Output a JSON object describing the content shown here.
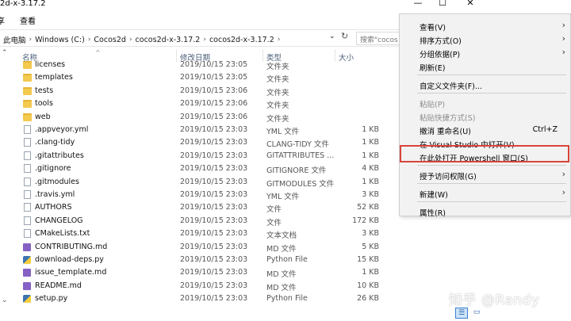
{
  "window": {
    "title": "2d-x-3.17.2",
    "controls": {
      "minimize": "—",
      "maximize": "☐",
      "close": "✕"
    }
  },
  "ribbon": {
    "left_fragment": "享",
    "view_tab": "查看"
  },
  "address": {
    "crumbs": [
      "此电脑",
      "Windows (C:)",
      "Cocos2d",
      "cocos2d-x-3.17.2",
      "cocos2d-x-3.17.2"
    ],
    "separator": "›",
    "search_placeholder": "搜索\"cocos"
  },
  "columns": {
    "name": "名称",
    "date": "修改日期",
    "type": "类型",
    "size": "大小"
  },
  "files": [
    {
      "name": "licenses",
      "date": "2019/10/15 23:05",
      "type": "文件夹",
      "size": "",
      "icon": "folder"
    },
    {
      "name": "templates",
      "date": "2019/10/15 23:05",
      "type": "文件夹",
      "size": "",
      "icon": "folder"
    },
    {
      "name": "tests",
      "date": "2019/10/15 23:06",
      "type": "文件夹",
      "size": "",
      "icon": "folder"
    },
    {
      "name": "tools",
      "date": "2019/10/15 23:06",
      "type": "文件夹",
      "size": "",
      "icon": "folder"
    },
    {
      "name": "web",
      "date": "2019/10/15 23:06",
      "type": "文件夹",
      "size": "",
      "icon": "folder"
    },
    {
      "name": ".appveyor.yml",
      "date": "2019/10/15 23:03",
      "type": "YML 文件",
      "size": "1 KB",
      "icon": "file"
    },
    {
      "name": ".clang-tidy",
      "date": "2019/10/15 23:03",
      "type": "CLANG-TIDY 文件",
      "size": "1 KB",
      "icon": "file"
    },
    {
      "name": ".gitattributes",
      "date": "2019/10/15 23:03",
      "type": "GITATTRIBUTES ...",
      "size": "1 KB",
      "icon": "file"
    },
    {
      "name": ".gitignore",
      "date": "2019/10/15 23:03",
      "type": "GITIGNORE 文件",
      "size": "4 KB",
      "icon": "file"
    },
    {
      "name": ".gitmodules",
      "date": "2019/10/15 23:03",
      "type": "GITMODULES 文件",
      "size": "1 KB",
      "icon": "file"
    },
    {
      "name": ".travis.yml",
      "date": "2019/10/15 23:03",
      "type": "YML 文件",
      "size": "3 KB",
      "icon": "file"
    },
    {
      "name": "AUTHORS",
      "date": "2019/10/15 23:03",
      "type": "文件",
      "size": "52 KB",
      "icon": "file"
    },
    {
      "name": "CHANGELOG",
      "date": "2019/10/15 23:03",
      "type": "文件",
      "size": "172 KB",
      "icon": "file"
    },
    {
      "name": "CMakeLists.txt",
      "date": "2019/10/15 23:03",
      "type": "文本文档",
      "size": "3 KB",
      "icon": "file"
    },
    {
      "name": "CONTRIBUTING.md",
      "date": "2019/10/15 23:03",
      "type": "MD 文件",
      "size": "5 KB",
      "icon": "vs"
    },
    {
      "name": "download-deps.py",
      "date": "2019/10/15 23:03",
      "type": "Python File",
      "size": "15 KB",
      "icon": "py"
    },
    {
      "name": "issue_template.md",
      "date": "2019/10/15 23:03",
      "type": "MD 文件",
      "size": "1 KB",
      "icon": "vs"
    },
    {
      "name": "README.md",
      "date": "2019/10/15 23:03",
      "type": "MD 文件",
      "size": "10 KB",
      "icon": "vs"
    },
    {
      "name": "setup.py",
      "date": "2019/10/15 23:03",
      "type": "Python File",
      "size": "26 KB",
      "icon": "py"
    }
  ],
  "context_menu": {
    "items": [
      {
        "label": "查看(V)",
        "arrow": "›",
        "shortcut": "",
        "disabled": false
      },
      {
        "label": "排序方式(O)",
        "arrow": "›",
        "shortcut": "",
        "disabled": false
      },
      {
        "label": "分组依据(P)",
        "arrow": "›",
        "shortcut": "",
        "disabled": false
      },
      {
        "label": "刷新(E)",
        "arrow": "",
        "shortcut": "",
        "disabled": false
      },
      {
        "label": "自定义文件夹(F)...",
        "arrow": "",
        "shortcut": "",
        "disabled": false
      },
      {
        "label": "粘贴(P)",
        "arrow": "",
        "shortcut": "",
        "disabled": true
      },
      {
        "label": "粘贴快捷方式(S)",
        "arrow": "",
        "shortcut": "",
        "disabled": true
      },
      {
        "label": "撤消 重命名(U)",
        "arrow": "",
        "shortcut": "Ctrl+Z",
        "disabled": false
      },
      {
        "label": "在 Visual Studio 中打开(V)",
        "arrow": "",
        "shortcut": "",
        "disabled": false
      },
      {
        "label": "在此处打开 Powershell 窗口(S)",
        "arrow": "",
        "shortcut": "",
        "disabled": false
      },
      {
        "label": "授予访问权限(G)",
        "arrow": "›",
        "shortcut": "",
        "disabled": false
      },
      {
        "label": "新建(W)",
        "arrow": "›",
        "shortcut": "",
        "disabled": false
      },
      {
        "label": "属性(R)",
        "arrow": "",
        "shortcut": "",
        "disabled": false
      }
    ]
  },
  "watermark": "知乎 @Randy",
  "colors": {
    "highlight_border": "#d9443b",
    "folder": "#f3c94e",
    "header_text": "#4c607a"
  }
}
